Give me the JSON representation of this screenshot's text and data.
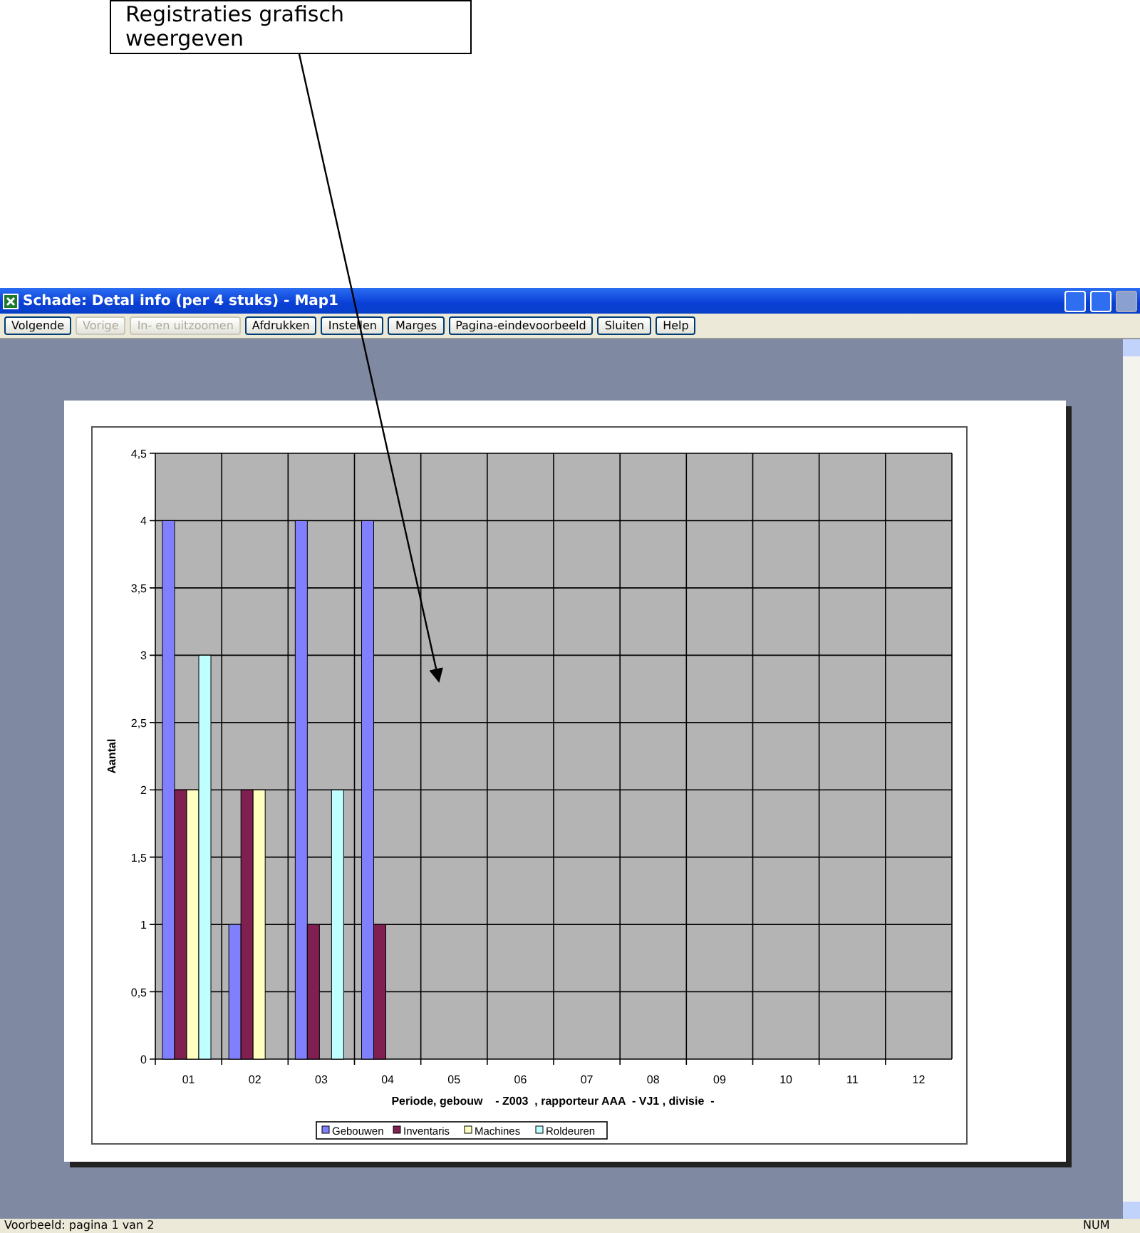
{
  "callout": {
    "text": "Registraties grafisch weergeven"
  },
  "window": {
    "title": "Schade: Detal info (per 4 stuks) - Map1"
  },
  "toolbar": [
    {
      "label": "Volgende",
      "disabled": false
    },
    {
      "label": "Vorige",
      "disabled": true
    },
    {
      "label": "In- en uitzoomen",
      "disabled": true
    },
    {
      "label": "Afdrukken",
      "disabled": false
    },
    {
      "label": "Instellen",
      "disabled": false
    },
    {
      "label": "Marges",
      "disabled": false
    },
    {
      "label": "Pagina-eindevoorbeeld",
      "disabled": false
    },
    {
      "label": "Sluiten",
      "disabled": false
    },
    {
      "label": "Help",
      "disabled": false
    }
  ],
  "chart": {
    "chart_data": {
      "type": "bar",
      "xlabel": "Periode, gebouw    - Z003  , rapporteur AAA  - VJ1 , divisie  -",
      "ylabel": "Aantal",
      "categories": [
        "01",
        "02",
        "03",
        "04",
        "05",
        "06",
        "07",
        "08",
        "09",
        "10",
        "11",
        "12"
      ],
      "series": [
        {
          "name": "Gebouwen",
          "color": "#8080ff",
          "values": [
            4,
            1,
            4,
            4,
            0,
            0,
            0,
            0,
            0,
            0,
            0,
            0
          ]
        },
        {
          "name": "Inventaris",
          "color": "#802050",
          "values": [
            2,
            2,
            1,
            1,
            0,
            0,
            0,
            0,
            0,
            0,
            0,
            0
          ]
        },
        {
          "name": "Machines",
          "color": "#ffffc0",
          "values": [
            2,
            2,
            0,
            0,
            0,
            0,
            0,
            0,
            0,
            0,
            0,
            0
          ]
        },
        {
          "name": "Roldeuren",
          "color": "#c0ffff",
          "values": [
            3,
            0,
            2,
            0,
            0,
            0,
            0,
            0,
            0,
            0,
            0,
            0
          ]
        }
      ],
      "ylim": [
        0,
        4.5
      ],
      "grid": true,
      "legend": true,
      "yticks": [
        0,
        {
          "value": 0.5,
          "label": "0,5"
        },
        1,
        {
          "value": 1.5,
          "label": "1,5"
        },
        2,
        {
          "value": 2.5,
          "label": "2,5"
        },
        3,
        {
          "value": 3.5,
          "label": "3,5"
        },
        4,
        {
          "value": 4.5,
          "label": "4,5"
        }
      ]
    }
  },
  "status_bar": {
    "text": "Voorbeeld: pagina 1 van 2",
    "indicator": "NUM"
  }
}
